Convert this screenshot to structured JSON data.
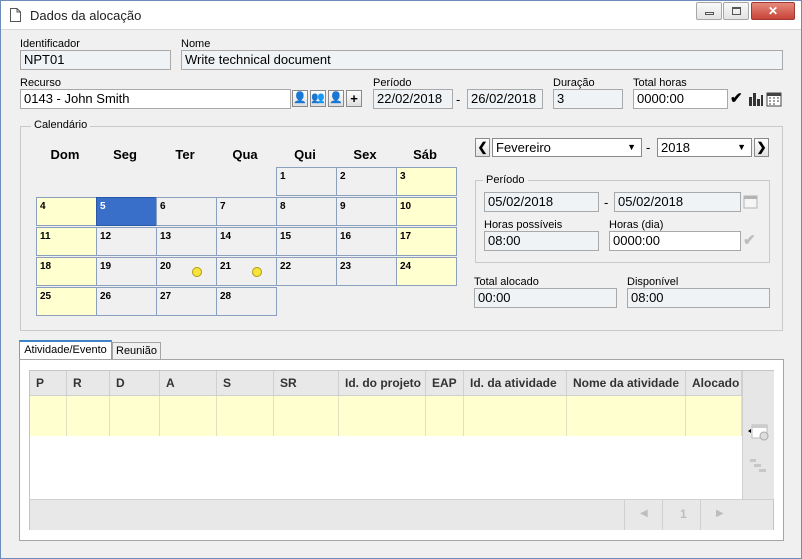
{
  "window": {
    "title": "Dados da alocação",
    "icons": {
      "doc": "document-icon",
      "minimize": "minimize-icon",
      "maximize": "maximize-icon",
      "close": "close-icon"
    }
  },
  "form": {
    "identificador": {
      "label": "Identificador",
      "value": "NPT01"
    },
    "nome": {
      "label": "Nome",
      "value": "Write technical document"
    },
    "recurso": {
      "label": "Recurso",
      "value": "0143 - John Smith"
    },
    "periodo": {
      "label": "Período",
      "start": "22/02/2018",
      "sep": "-",
      "end": "26/02/2018"
    },
    "duracao": {
      "label": "Duração",
      "value": "3"
    },
    "total_horas": {
      "label": "Total horas",
      "value": "0000:00"
    }
  },
  "calendar": {
    "legend": "Calendário",
    "weekdays": [
      "Dom",
      "Seg",
      "Ter",
      "Qua",
      "Qui",
      "Sex",
      "Sáb"
    ],
    "month_select": "Fevereiro",
    "sep": "-",
    "year_select": "2018",
    "selected_day": "5",
    "days_with_clock": [
      "20",
      "21"
    ],
    "weeks": [
      [
        "",
        "",
        "",
        "",
        "1",
        "2",
        "3"
      ],
      [
        "4",
        "5",
        "6",
        "7",
        "8",
        "9",
        "10"
      ],
      [
        "11",
        "12",
        "13",
        "14",
        "15",
        "16",
        "17"
      ],
      [
        "18",
        "19",
        "20",
        "21",
        "22",
        "23",
        "24"
      ],
      [
        "25",
        "26",
        "27",
        "28",
        "",
        "",
        ""
      ]
    ]
  },
  "period_box": {
    "legend": "Período",
    "start": "05/02/2018",
    "sep": "-",
    "end": "05/02/2018",
    "horas_possiveis": {
      "label": "Horas possíveis",
      "value": "08:00"
    },
    "horas_dia": {
      "label": "Horas (dia)",
      "value": "0000:00"
    }
  },
  "totals": {
    "total_alocado": {
      "label": "Total alocado",
      "value": "00:00"
    },
    "disponivel": {
      "label": "Disponível",
      "value": "08:00"
    }
  },
  "tabs": [
    "Atividade/Evento",
    "Reunião"
  ],
  "grid": {
    "columns": [
      "P",
      "R",
      "D",
      "A",
      "S",
      "SR",
      "Id. do projeto",
      "EAP",
      "Id. da atividade",
      "Nome da atividade",
      "Alocado"
    ],
    "pager": {
      "page": "1"
    }
  },
  "colors": {
    "accent": "#3a6fc9",
    "weekend": "#ffffd0",
    "row_highlight": "#ffffd0"
  }
}
